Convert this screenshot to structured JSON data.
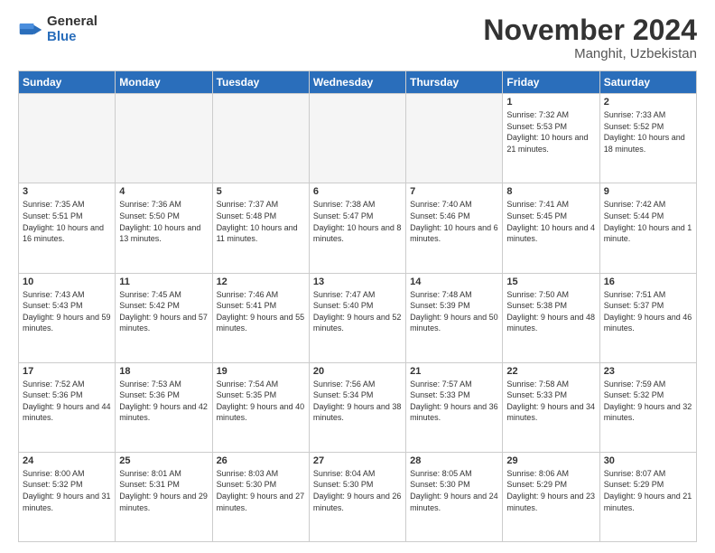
{
  "header": {
    "logo_general": "General",
    "logo_blue": "Blue",
    "month": "November 2024",
    "location": "Manghit, Uzbekistan"
  },
  "weekdays": [
    "Sunday",
    "Monday",
    "Tuesday",
    "Wednesday",
    "Thursday",
    "Friday",
    "Saturday"
  ],
  "weeks": [
    [
      {
        "day": "",
        "info": ""
      },
      {
        "day": "",
        "info": ""
      },
      {
        "day": "",
        "info": ""
      },
      {
        "day": "",
        "info": ""
      },
      {
        "day": "",
        "info": ""
      },
      {
        "day": "1",
        "info": "Sunrise: 7:32 AM\nSunset: 5:53 PM\nDaylight: 10 hours and 21 minutes."
      },
      {
        "day": "2",
        "info": "Sunrise: 7:33 AM\nSunset: 5:52 PM\nDaylight: 10 hours and 18 minutes."
      }
    ],
    [
      {
        "day": "3",
        "info": "Sunrise: 7:35 AM\nSunset: 5:51 PM\nDaylight: 10 hours and 16 minutes."
      },
      {
        "day": "4",
        "info": "Sunrise: 7:36 AM\nSunset: 5:50 PM\nDaylight: 10 hours and 13 minutes."
      },
      {
        "day": "5",
        "info": "Sunrise: 7:37 AM\nSunset: 5:48 PM\nDaylight: 10 hours and 11 minutes."
      },
      {
        "day": "6",
        "info": "Sunrise: 7:38 AM\nSunset: 5:47 PM\nDaylight: 10 hours and 8 minutes."
      },
      {
        "day": "7",
        "info": "Sunrise: 7:40 AM\nSunset: 5:46 PM\nDaylight: 10 hours and 6 minutes."
      },
      {
        "day": "8",
        "info": "Sunrise: 7:41 AM\nSunset: 5:45 PM\nDaylight: 10 hours and 4 minutes."
      },
      {
        "day": "9",
        "info": "Sunrise: 7:42 AM\nSunset: 5:44 PM\nDaylight: 10 hours and 1 minute."
      }
    ],
    [
      {
        "day": "10",
        "info": "Sunrise: 7:43 AM\nSunset: 5:43 PM\nDaylight: 9 hours and 59 minutes."
      },
      {
        "day": "11",
        "info": "Sunrise: 7:45 AM\nSunset: 5:42 PM\nDaylight: 9 hours and 57 minutes."
      },
      {
        "day": "12",
        "info": "Sunrise: 7:46 AM\nSunset: 5:41 PM\nDaylight: 9 hours and 55 minutes."
      },
      {
        "day": "13",
        "info": "Sunrise: 7:47 AM\nSunset: 5:40 PM\nDaylight: 9 hours and 52 minutes."
      },
      {
        "day": "14",
        "info": "Sunrise: 7:48 AM\nSunset: 5:39 PM\nDaylight: 9 hours and 50 minutes."
      },
      {
        "day": "15",
        "info": "Sunrise: 7:50 AM\nSunset: 5:38 PM\nDaylight: 9 hours and 48 minutes."
      },
      {
        "day": "16",
        "info": "Sunrise: 7:51 AM\nSunset: 5:37 PM\nDaylight: 9 hours and 46 minutes."
      }
    ],
    [
      {
        "day": "17",
        "info": "Sunrise: 7:52 AM\nSunset: 5:36 PM\nDaylight: 9 hours and 44 minutes."
      },
      {
        "day": "18",
        "info": "Sunrise: 7:53 AM\nSunset: 5:36 PM\nDaylight: 9 hours and 42 minutes."
      },
      {
        "day": "19",
        "info": "Sunrise: 7:54 AM\nSunset: 5:35 PM\nDaylight: 9 hours and 40 minutes."
      },
      {
        "day": "20",
        "info": "Sunrise: 7:56 AM\nSunset: 5:34 PM\nDaylight: 9 hours and 38 minutes."
      },
      {
        "day": "21",
        "info": "Sunrise: 7:57 AM\nSunset: 5:33 PM\nDaylight: 9 hours and 36 minutes."
      },
      {
        "day": "22",
        "info": "Sunrise: 7:58 AM\nSunset: 5:33 PM\nDaylight: 9 hours and 34 minutes."
      },
      {
        "day": "23",
        "info": "Sunrise: 7:59 AM\nSunset: 5:32 PM\nDaylight: 9 hours and 32 minutes."
      }
    ],
    [
      {
        "day": "24",
        "info": "Sunrise: 8:00 AM\nSunset: 5:32 PM\nDaylight: 9 hours and 31 minutes."
      },
      {
        "day": "25",
        "info": "Sunrise: 8:01 AM\nSunset: 5:31 PM\nDaylight: 9 hours and 29 minutes."
      },
      {
        "day": "26",
        "info": "Sunrise: 8:03 AM\nSunset: 5:30 PM\nDaylight: 9 hours and 27 minutes."
      },
      {
        "day": "27",
        "info": "Sunrise: 8:04 AM\nSunset: 5:30 PM\nDaylight: 9 hours and 26 minutes."
      },
      {
        "day": "28",
        "info": "Sunrise: 8:05 AM\nSunset: 5:30 PM\nDaylight: 9 hours and 24 minutes."
      },
      {
        "day": "29",
        "info": "Sunrise: 8:06 AM\nSunset: 5:29 PM\nDaylight: 9 hours and 23 minutes."
      },
      {
        "day": "30",
        "info": "Sunrise: 8:07 AM\nSunset: 5:29 PM\nDaylight: 9 hours and 21 minutes."
      }
    ]
  ]
}
